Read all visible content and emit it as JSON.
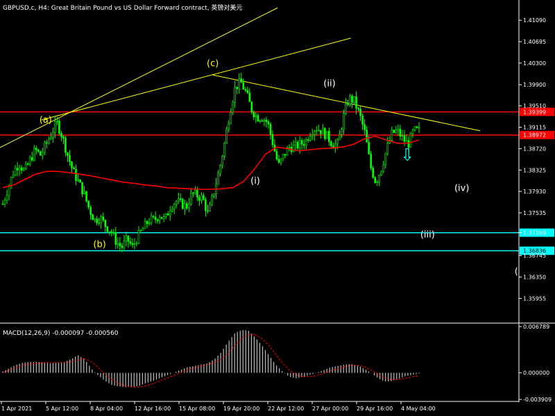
{
  "header": {
    "title": "GBPUSD.c, H4:  Great Britain Pound vs US Dollar Forward contract, 英镑对美元"
  },
  "colors": {
    "background": "#000000",
    "candle": "#00ff00",
    "ma": "#ff0000",
    "trend": "#ffff00",
    "resistance": "#ff0000",
    "support": "#00ffff",
    "axis": "#ffffff",
    "macd_hist": "#c0c0c0",
    "macd_signal": "#ff0000",
    "arrow": "#00ffff"
  },
  "chart_data": [
    {
      "type": "candlestick",
      "symbol": "GBPUSD.c",
      "timeframe": "H4",
      "ylim": [
        1.355,
        1.414
      ],
      "yticks": [
        "1.41090",
        "1.40695",
        "1.40300",
        "1.39900",
        "1.39510",
        "1.39115",
        "1.38720",
        "1.38325",
        "1.37930",
        "1.37535",
        "1.37169",
        "1.36745",
        "1.36350",
        "1.35955"
      ],
      "xticks": [
        "1 Apr 2021",
        "5 Apr 12:00",
        "8 Apr 04:00",
        "12 Apr 16:00",
        "15 Apr 08:00",
        "19 Apr 20:00",
        "22 Apr 12:00",
        "27 Apr 00:00",
        "29 Apr 16:00",
        "4 May 04:00"
      ],
      "close_path": [
        1.377,
        1.38,
        1.383,
        1.3845,
        1.383,
        1.385,
        1.387,
        1.386,
        1.388,
        1.39,
        1.392,
        1.3895,
        1.386,
        1.383,
        1.381,
        1.379,
        1.376,
        1.374,
        1.3745,
        1.373,
        1.372,
        1.37,
        1.369,
        1.3705,
        1.369,
        1.371,
        1.3725,
        1.374,
        1.374,
        1.375,
        1.374,
        1.3765,
        1.3775,
        1.377,
        1.3765,
        1.379,
        1.3785,
        1.378,
        1.375,
        1.379,
        1.383,
        1.388,
        1.394,
        1.3985,
        1.3995,
        1.3975,
        1.3945,
        1.393,
        1.393,
        1.392,
        1.388,
        1.384,
        1.386,
        1.3875,
        1.3875,
        1.388,
        1.3885,
        1.3905,
        1.391,
        1.3905,
        1.3895,
        1.388,
        1.388,
        1.393,
        1.3965,
        1.396,
        1.3935,
        1.39,
        1.384,
        1.381,
        1.3835,
        1.387,
        1.39,
        1.3905,
        1.389,
        1.388,
        1.3905,
        1.3905
      ],
      "ma_path": [
        1.38,
        1.3805,
        1.3815,
        1.3825,
        1.383,
        1.383,
        1.3828,
        1.3825,
        1.3822,
        1.3818,
        1.3814,
        1.381,
        1.3808,
        1.3805,
        1.3803,
        1.38,
        1.3799,
        1.3798,
        1.3797,
        1.3797,
        1.3798,
        1.38,
        1.3812,
        1.3835,
        1.3862,
        1.3875,
        1.3872,
        1.3868,
        1.387,
        1.3872,
        1.3873,
        1.3875,
        1.388,
        1.389,
        1.3895,
        1.3888,
        1.3882,
        1.3882,
        1.3888
      ],
      "horizontal_levels": [
        {
          "value": 1.39399,
          "label": "1.39399",
          "color": "#ff0000"
        },
        {
          "value": 1.38972,
          "label": "1.38972",
          "color": "#ff0000"
        },
        {
          "value": 1.37169,
          "label": "1.37169",
          "color": "#00ffff"
        },
        {
          "value": 1.36836,
          "label": "1.36836",
          "color": "#00ffff"
        }
      ],
      "trend_lines": [
        {
          "from": [
            0.0,
            1.3874
          ],
          "to": [
            0.535,
            1.4132
          ]
        },
        {
          "from": [
            0.08,
            1.3925
          ],
          "to": [
            0.676,
            1.4076
          ]
        },
        {
          "from": [
            0.41,
            1.4008
          ],
          "to": [
            0.925,
            1.3905
          ]
        }
      ],
      "wave_labels": [
        {
          "text": "(a)",
          "x": 0.088,
          "y": 1.392,
          "color": "#ffff00"
        },
        {
          "text": "(b)",
          "x": 0.192,
          "y": 1.369,
          "color": "#ffff00"
        },
        {
          "text": "(c)",
          "x": 0.41,
          "y": 1.4024,
          "color": "#ffff00"
        },
        {
          "text": "(i)",
          "x": 0.492,
          "y": 1.3807,
          "color": "#ffffff"
        },
        {
          "text": "(ii)",
          "x": 0.635,
          "y": 1.3987,
          "color": "#ffffff"
        },
        {
          "text": "(iii)",
          "x": 0.824,
          "y": 1.3708,
          "color": "#ffffff"
        },
        {
          "text": "(iv)",
          "x": 0.89,
          "y": 1.3794,
          "color": "#ffffff"
        },
        {
          "text": "(",
          "x": 0.995,
          "y": 1.364,
          "color": "#ffffff"
        }
      ],
      "arrow": {
        "symbol": "⇩",
        "x": 0.785,
        "y": 1.385
      }
    },
    {
      "type": "macd",
      "label": "MACD(12,26,9) -0.000097 -0.000560",
      "ylim": [
        -0.0041,
        0.0071
      ],
      "yticks": [
        "0.006789",
        "0.000000",
        "-0.003909"
      ],
      "histogram": [
        0.0002,
        0.0007,
        0.0012,
        0.0015,
        0.0016,
        0.0016,
        0.0015,
        0.0014,
        0.0015,
        0.0016,
        0.002,
        0.0026,
        0.002,
        0.0006,
        -0.0004,
        -0.0012,
        -0.0018,
        -0.002,
        -0.0021,
        -0.0021,
        -0.0019,
        -0.0015,
        -0.0012,
        -0.0008,
        -0.0004,
        0.0,
        0.0004,
        0.0008,
        0.001,
        0.0012,
        0.0014,
        0.002,
        0.003,
        0.0045,
        0.0058,
        0.0063,
        0.0062,
        0.0052,
        0.004,
        0.0026,
        0.0012,
        0.0002,
        -0.0006,
        -0.0008,
        -0.0006,
        -0.0003,
        0.0,
        0.0004,
        0.0008,
        0.001,
        0.0012,
        0.0013,
        0.0011,
        0.0006,
        0.0,
        -0.0008,
        -0.0013,
        -0.0012,
        -0.0009,
        -0.0005,
        -0.0003,
        -0.0001
      ],
      "signal": [
        0.0,
        0.0004,
        0.0008,
        0.0011,
        0.0013,
        0.0014,
        0.0015,
        0.0015,
        0.0015,
        0.0015,
        0.0016,
        0.0019,
        0.0021,
        0.0016,
        0.0008,
        -0.0002,
        -0.001,
        -0.0016,
        -0.0019,
        -0.0021,
        -0.0021,
        -0.0019,
        -0.0016,
        -0.0012,
        -0.0008,
        -0.0004,
        0.0,
        0.0004,
        0.0007,
        0.001,
        0.0012,
        0.0015,
        0.002,
        0.0028,
        0.004,
        0.005,
        0.0056,
        0.0056,
        0.005,
        0.004,
        0.0027,
        0.0014,
        0.0004,
        -0.0003,
        -0.0006,
        -0.0006,
        -0.0004,
        -0.0001,
        0.0003,
        0.0006,
        0.0009,
        0.0011,
        0.0011,
        0.0009,
        0.0004,
        -0.0002,
        -0.0008,
        -0.001,
        -0.001,
        -0.0008,
        -0.0006,
        -0.0004
      ]
    }
  ]
}
